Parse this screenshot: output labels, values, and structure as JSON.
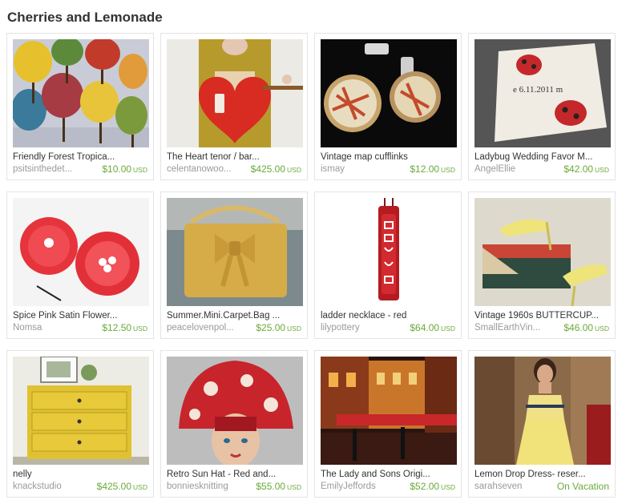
{
  "treasury": {
    "title": "Cherries and Lemonade",
    "items": [
      {
        "title": "Friendly Forest Tropica...",
        "shop": "psitsinthedet...",
        "price": "$10.00",
        "currency": "USD",
        "image": "tree-cutouts"
      },
      {
        "title": "The Heart tenor / bar...",
        "shop": "celentanowoo...",
        "price": "$425.00",
        "currency": "USD",
        "image": "red-heart-ukulele"
      },
      {
        "title": "Vintage map cufflinks",
        "shop": "ismay",
        "price": "$12.00",
        "currency": "USD",
        "image": "map-cufflinks"
      },
      {
        "title": "Ladybug Wedding Favor M...",
        "shop": "AngelEllie",
        "price": "$42.00",
        "currency": "USD",
        "image": "ladybug-tile"
      },
      {
        "title": "Spice Pink Satin Flower...",
        "shop": "Nomsa",
        "price": "$12.50",
        "currency": "USD",
        "image": "satin-flower-clips"
      },
      {
        "title": "Summer.Mini.Carpet.Bag ...",
        "shop": "peacelovenpol...",
        "price": "$25.00",
        "currency": "USD",
        "image": "yellow-bow-bag"
      },
      {
        "title": "ladder necklace - red",
        "shop": "lilypottery",
        "price": "$64.00",
        "currency": "USD",
        "image": "red-ceramic-pendant"
      },
      {
        "title": "Vintage 1960s BUTTERCUP...",
        "shop": "SmallEarthVin...",
        "price": "$46.00",
        "currency": "USD",
        "image": "yellow-heels"
      },
      {
        "title": "nelly",
        "shop": "knackstudio",
        "price": "$425.00",
        "currency": "USD",
        "image": "yellow-dresser"
      },
      {
        "title": "Retro Sun Hat - Red and...",
        "shop": "bonniesknitting",
        "price": "$55.00",
        "currency": "USD",
        "image": "red-sun-hat"
      },
      {
        "title": "The Lady and Sons Origi...",
        "shop": "EmilyJeffords",
        "price": "$52.00",
        "currency": "USD",
        "image": "street-night-painting"
      },
      {
        "title": "Lemon Drop Dress- reser...",
        "shop": "sarahseven",
        "status": "On Vacation",
        "image": "yellow-dress"
      }
    ]
  },
  "colors": {
    "title": "#333333",
    "shop": "#9a9a9a",
    "price": "#6aaa3a",
    "border": "#e4e4e4"
  }
}
